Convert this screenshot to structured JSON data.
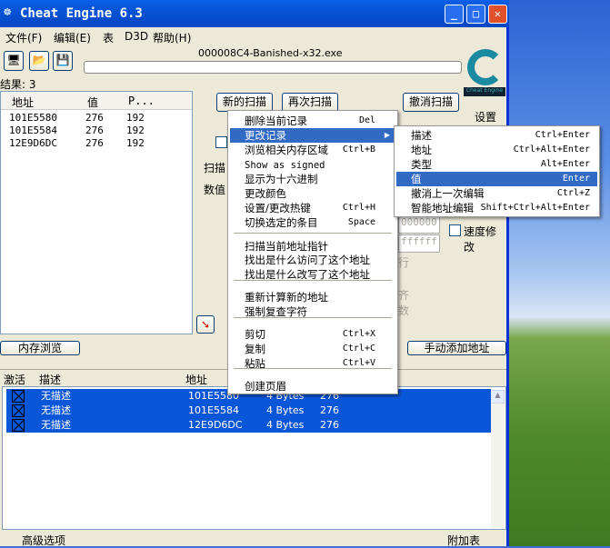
{
  "window": {
    "title": "Cheat Engine 6.3",
    "process": "000008C4-Banished-x32.exe"
  },
  "menubar": [
    "文件(F)",
    "编辑(E)",
    "表",
    "D3D",
    "帮助(H)"
  ],
  "results_label": "结果: 3",
  "results_table": {
    "headers": [
      "地址",
      "值",
      "P..."
    ],
    "rows": [
      [
        "101E5580",
        "276",
        "192"
      ],
      [
        "101E5584",
        "276",
        "192"
      ],
      [
        "12E9D6DC",
        "276",
        "192"
      ]
    ]
  },
  "buttons": {
    "new_scan": "新的扫描",
    "next_scan": "再次扫描",
    "undo_scan": "撤消扫描",
    "settings": "设置",
    "memory_view": "内存浏览",
    "add_address": "手动添加地址",
    "logo_text": "Cheat Engine"
  },
  "background_fragments": {
    "scan_type": "扫描",
    "value": "数值",
    "hex1": "000000",
    "hex2": "ffffff",
    "exec": "行",
    "align": "齐",
    "digits": "数",
    "speedhack": "速度修改"
  },
  "context_menu": [
    {
      "label": "删除当前记录",
      "shortcut": "Del"
    },
    {
      "label": "更改记录",
      "shortcut": "",
      "submenu": true,
      "highlighted": true
    },
    {
      "label": "浏览相关内存区域",
      "shortcut": "Ctrl+B"
    },
    {
      "label": "Show as signed",
      "shortcut": ""
    },
    {
      "label": "显示为十六进制",
      "shortcut": ""
    },
    {
      "label": "更改颜色",
      "shortcut": ""
    },
    {
      "label": "设置/更改热键",
      "shortcut": "Ctrl+H"
    },
    {
      "label": "切换选定的条目",
      "shortcut": "Space"
    },
    {
      "label": "扫描当前地址指针",
      "shortcut": ""
    },
    {
      "label": "找出是什么访问了这个地址",
      "shortcut": ""
    },
    {
      "label": "找出是什么改写了这个地址",
      "shortcut": ""
    },
    {
      "label": "重新计算新的地址",
      "shortcut": ""
    },
    {
      "label": "强制复查字符",
      "shortcut": ""
    },
    {
      "label": "剪切",
      "shortcut": "Ctrl+X"
    },
    {
      "label": "复制",
      "shortcut": "Ctrl+C"
    },
    {
      "label": "粘贴",
      "shortcut": "Ctrl+V"
    },
    {
      "label": "创建页眉",
      "shortcut": ""
    }
  ],
  "submenu": [
    {
      "label": "描述",
      "shortcut": "Ctrl+Enter"
    },
    {
      "label": "地址",
      "shortcut": "Ctrl+Alt+Enter"
    },
    {
      "label": "类型",
      "shortcut": "Alt+Enter"
    },
    {
      "label": "值",
      "shortcut": "Enter",
      "highlighted": true
    },
    {
      "label": "撤消上一次编辑",
      "shortcut": "Ctrl+Z"
    },
    {
      "label": "智能地址编辑",
      "shortcut": "Shift+Ctrl+Alt+Enter"
    }
  ],
  "address_list": {
    "headers": [
      "激活",
      "描述",
      "地址"
    ],
    "rows": [
      {
        "active": true,
        "description": "无描述",
        "address": "101E5580",
        "type": "4 Bytes",
        "value": "276"
      },
      {
        "active": true,
        "description": "无描述",
        "address": "101E5584",
        "type": "4 Bytes",
        "value": "276"
      },
      {
        "active": true,
        "description": "无描述",
        "address": "12E9D6DC",
        "type": "4 Bytes",
        "value": "276"
      }
    ]
  },
  "statusbar": {
    "left": "高级选项",
    "right": "附加表"
  },
  "colors": {
    "selection": "#0a56d8",
    "menu_highlight": "#316ac5",
    "titlebar": "#0653d6"
  }
}
